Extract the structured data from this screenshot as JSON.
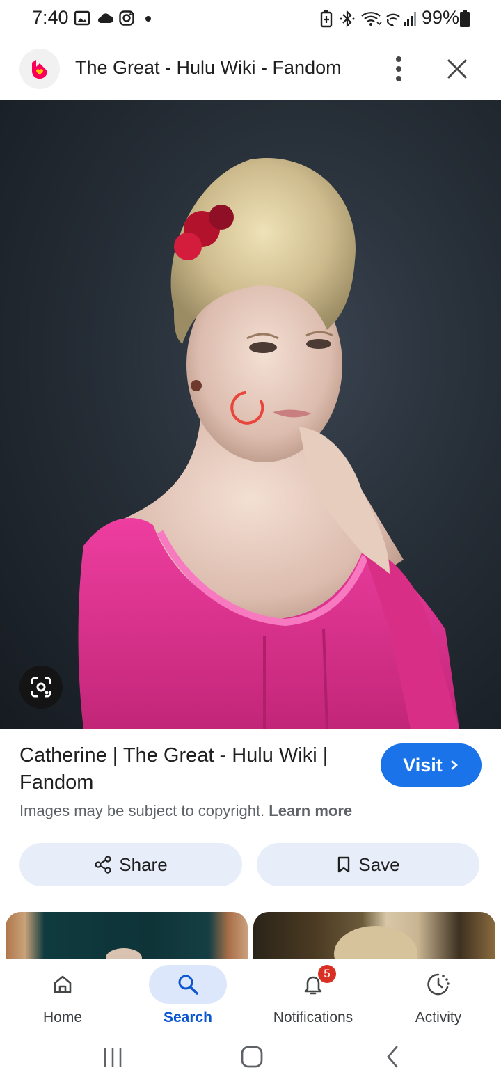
{
  "status_bar": {
    "time": "7:40",
    "battery_percent": "99%",
    "icons": [
      "gallery-icon",
      "cloud-icon",
      "instagram-icon",
      "dot-icon",
      "battery-saver-icon",
      "bluetooth-icon",
      "wifi-icon",
      "wifi-call-icon",
      "signal-icon",
      "battery-icon"
    ]
  },
  "header": {
    "logo_icon": "fandom-logo-icon",
    "title": "The Great - Hulu Wiki - Fandom",
    "more_icon": "more-vert-icon",
    "close_icon": "close-icon"
  },
  "image": {
    "loading_spinner_color": "#e8453c",
    "lens_icon": "google-lens-icon"
  },
  "result": {
    "title": "Catherine | The Great - Hulu Wiki | Fandom",
    "visit_label": "Visit",
    "copyright_text": "Images may be subject to copyright.",
    "learn_more": "Learn more",
    "share_label": "Share",
    "save_label": "Save"
  },
  "bottom_nav": {
    "items": [
      {
        "label": "Home",
        "icon": "home-icon"
      },
      {
        "label": "Search",
        "icon": "search-icon",
        "active": true
      },
      {
        "label": "Notifications",
        "icon": "bell-icon",
        "badge": "5"
      },
      {
        "label": "Activity",
        "icon": "activity-icon"
      }
    ]
  },
  "colors": {
    "accent": "#1a73e8",
    "active_nav": "#0b57d0",
    "chip_bg": "#e8eef9",
    "badge": "#d93025",
    "dress": "#e0338f"
  }
}
